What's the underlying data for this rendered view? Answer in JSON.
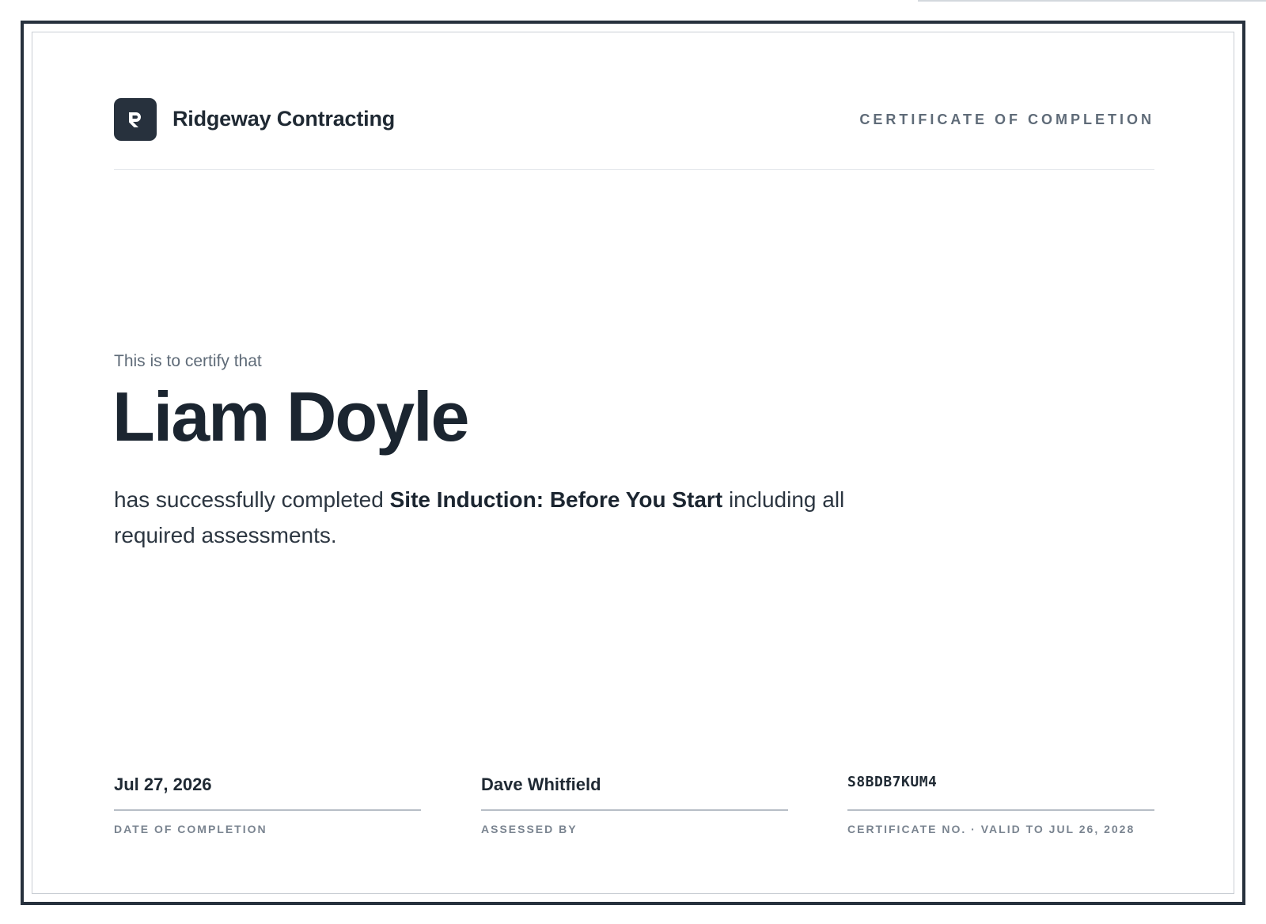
{
  "colors": {
    "frame": "#27313d",
    "ink": "#1b2530",
    "muted": "#5f6b78",
    "rule": "#b7bec6"
  },
  "brand": {
    "logo_letter": "R",
    "logo_icon": "ridgeway-logo-icon",
    "name": "Ridgeway Contracting"
  },
  "header": {
    "document_type": "CERTIFICATE OF COMPLETION"
  },
  "body": {
    "lead": "This is to certify that",
    "recipient_name": "Liam Doyle",
    "statement_prefix": "has successfully completed",
    "course_title": "Site Induction: Before You Start",
    "statement_suffix": "including all required assessments."
  },
  "footer": {
    "date": {
      "value": "Jul 27, 2026",
      "label": "DATE OF COMPLETION"
    },
    "assessor": {
      "value": "Dave Whitfield",
      "label": "ASSESSED BY"
    },
    "certificate": {
      "value": "S8BDB7KUM4",
      "label": "CERTIFICATE NO. · VALID TO JUL 26, 2028"
    }
  }
}
